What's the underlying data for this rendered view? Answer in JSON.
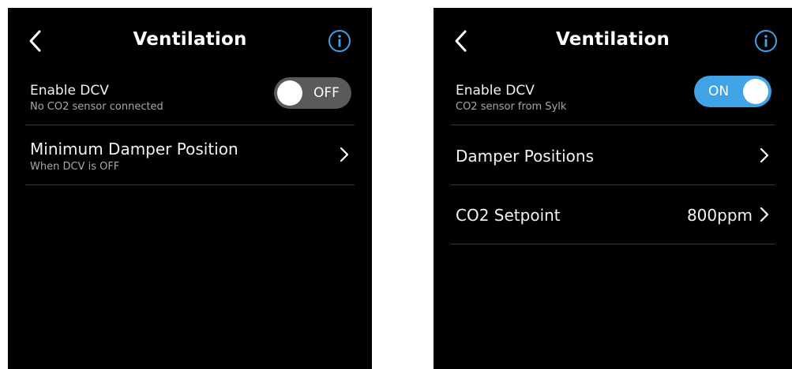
{
  "colors": {
    "background": "#000000",
    "toggle_off": "#5a5a5a",
    "toggle_on": "#3fa3e6",
    "info_icon": "#3fa3e6"
  },
  "left": {
    "title": "Ventilation",
    "back_icon": "chevron-left-icon",
    "info_icon": "info-icon",
    "rows": [
      {
        "label": "Enable DCV",
        "sublabel": "No CO2 sensor connected",
        "toggle_state": "OFF"
      },
      {
        "label": "Minimum Damper Position",
        "sublabel": "When DCV is OFF"
      }
    ]
  },
  "right": {
    "title": "Ventilation",
    "back_icon": "chevron-left-icon",
    "info_icon": "info-icon",
    "rows": [
      {
        "label": "Enable DCV",
        "sublabel": "CO2 sensor from Sylk",
        "toggle_state": "ON"
      },
      {
        "label": "Damper Positions"
      },
      {
        "label": "CO2 Setpoint",
        "value": "800ppm"
      }
    ]
  }
}
